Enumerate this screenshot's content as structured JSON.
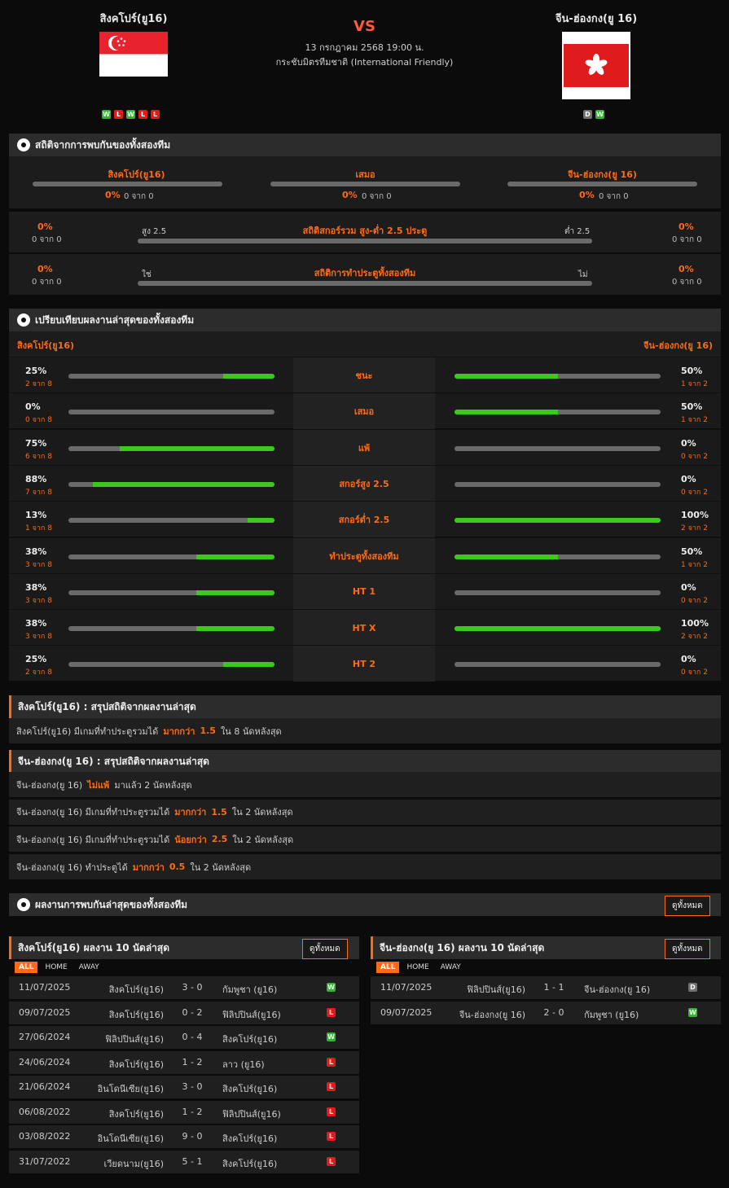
{
  "header": {
    "home_name": "สิงคโปร์(ยู16)",
    "away_name": "จีน-ฮ่องกง(ยู 16)",
    "vs": "VS",
    "date_time": "13 กรกฎาคม 2568 19:00 น.",
    "competition": "กระชับมิตรทีมชาติ (International Friendly)",
    "home_form": [
      "W",
      "L",
      "W",
      "L",
      "L"
    ],
    "away_form": [
      "D",
      "W"
    ]
  },
  "h2h": {
    "title": "สถิติจากการพบกันของทั้งสองทีม",
    "cols": [
      {
        "label": "สิงคโปร์(ยู16)",
        "pct": "0%",
        "count": "0 จาก 0"
      },
      {
        "label": "เสมอ",
        "pct": "0%",
        "count": "0 จาก 0"
      },
      {
        "label": "จีน-ฮ่องกง(ยู 16)",
        "pct": "0%",
        "count": "0 จาก 0"
      }
    ],
    "ou": {
      "title": "สถิติสกอร์รวม สูง-ต่ำ 2.5 ประตู",
      "left_label": "สูง 2.5",
      "right_label": "ต่ำ 2.5",
      "left_pct": "0%",
      "left_count": "0 จาก 0",
      "right_pct": "0%",
      "right_count": "0 จาก 0"
    },
    "btts": {
      "title": "สถิติการทำประตูทั้งสองทีม",
      "left_label": "ใช่",
      "right_label": "ไม่",
      "left_pct": "0%",
      "left_count": "0 จาก 0",
      "right_pct": "0%",
      "right_count": "0 จาก 0"
    }
  },
  "compare": {
    "title": "เปรียบเทียบผลงานล่าสุดของทั้งสองทีม",
    "home_name": "สิงคโปร์(ยู16)",
    "away_name": "จีน-ฮ่องกง(ยู 16)",
    "rows": [
      {
        "label": "ชนะ",
        "home_pct": "25%",
        "home_count": "2 จาก 8",
        "home_val": 0.25,
        "away_pct": "50%",
        "away_count": "1 จาก 2",
        "away_val": 0.5
      },
      {
        "label": "เสมอ",
        "home_pct": "0%",
        "home_count": "0 จาก 8",
        "home_val": 0,
        "away_pct": "50%",
        "away_count": "1 จาก 2",
        "away_val": 0.5
      },
      {
        "label": "แพ้",
        "home_pct": "75%",
        "home_count": "6 จาก 8",
        "home_val": 0.75,
        "away_pct": "0%",
        "away_count": "0 จาก 2",
        "away_val": 0
      },
      {
        "label": "สกอร์สูง 2.5",
        "home_pct": "88%",
        "home_count": "7 จาก 8",
        "home_val": 0.88,
        "away_pct": "0%",
        "away_count": "0 จาก 2",
        "away_val": 0
      },
      {
        "label": "สกอร์ต่ำ 2.5",
        "home_pct": "13%",
        "home_count": "1 จาก 8",
        "home_val": 0.13,
        "away_pct": "100%",
        "away_count": "2 จาก 2",
        "away_val": 1
      },
      {
        "label": "ทำประตูทั้งสองทีม",
        "home_pct": "38%",
        "home_count": "3 จาก 8",
        "home_val": 0.38,
        "away_pct": "50%",
        "away_count": "1 จาก 2",
        "away_val": 0.5
      },
      {
        "label": "HT 1",
        "home_pct": "38%",
        "home_count": "3 จาก 8",
        "home_val": 0.38,
        "away_pct": "0%",
        "away_count": "0 จาก 2",
        "away_val": 0
      },
      {
        "label": "HT X",
        "home_pct": "38%",
        "home_count": "3 จาก 8",
        "home_val": 0.38,
        "away_pct": "100%",
        "away_count": "2 จาก 2",
        "away_val": 1
      },
      {
        "label": "HT 2",
        "home_pct": "25%",
        "home_count": "2 จาก 8",
        "home_val": 0.25,
        "away_pct": "0%",
        "away_count": "0 จาก 2",
        "away_val": 0
      }
    ]
  },
  "home_summary": {
    "title": "สิงคโปร์(ยู16) : สรุปสถิติจากผลงานล่าสุด",
    "rows": [
      {
        "a": "สิงคโปร์(ยู16) มีเกมที่ทำประตูรวมได้",
        "b": "มากกว่า",
        "c": "1.5",
        "d": "ใน 8 นัดหลังสุด"
      }
    ]
  },
  "away_summary": {
    "title": "จีน-ฮ่องกง(ยู 16) : สรุปสถิติจากผลงานล่าสุด",
    "rows": [
      {
        "a": "จีน-ฮ่องกง(ยู 16)",
        "b": "ไม่แพ้",
        "c": "",
        "d": "มาแล้ว 2 นัดหลังสุด"
      },
      {
        "a": "จีน-ฮ่องกง(ยู 16) มีเกมที่ทำประตูรวมได้",
        "b": "มากกว่า",
        "c": "1.5",
        "d": "ใน 2 นัดหลังสุด"
      },
      {
        "a": "จีน-ฮ่องกง(ยู 16) มีเกมที่ทำประตูรวมได้",
        "b": "น้อยกว่า",
        "c": "2.5",
        "d": "ใน 2 นัดหลังสุด"
      },
      {
        "a": "จีน-ฮ่องกง(ยู 16) ทำประตูได้",
        "b": "มากกว่า",
        "c": "0.5",
        "d": "ใน 2 นัดหลังสุด"
      }
    ]
  },
  "recent": {
    "title": "ผลงานการพบกันล่าสุดของทั้งสองทีม",
    "view_all": "ดูทั้งหมด",
    "tabs": [
      "ALL",
      "HOME",
      "AWAY"
    ],
    "home": {
      "title": "สิงคโปร์(ยู16) ผลงาน 10 นัดล่าสุด",
      "matches": [
        {
          "date": "11/07/2025",
          "home": "สิงคโปร์(ยู16)",
          "score": "3 - 0",
          "away": "กัมพูชา (ยู16)",
          "res": "W"
        },
        {
          "date": "09/07/2025",
          "home": "สิงคโปร์(ยู16)",
          "score": "0 - 2",
          "away": "ฟิลิปปินส์(ยู16)",
          "res": "L"
        },
        {
          "date": "27/06/2024",
          "home": "ฟิลิปปินส์(ยู16)",
          "score": "0 - 4",
          "away": "สิงคโปร์(ยู16)",
          "res": "W"
        },
        {
          "date": "24/06/2024",
          "home": "สิงคโปร์(ยู16)",
          "score": "1 - 2",
          "away": "ลาว (ยู16)",
          "res": "L"
        },
        {
          "date": "21/06/2024",
          "home": "อินโดนีเซีย(ยู16)",
          "score": "3 - 0",
          "away": "สิงคโปร์(ยู16)",
          "res": "L"
        },
        {
          "date": "06/08/2022",
          "home": "สิงคโปร์(ยู16)",
          "score": "1 - 2",
          "away": "ฟิลิปปินส์(ยู16)",
          "res": "L"
        },
        {
          "date": "03/08/2022",
          "home": "อินโดนีเซีย(ยู16)",
          "score": "9 - 0",
          "away": "สิงคโปร์(ยู16)",
          "res": "L"
        },
        {
          "date": "31/07/2022",
          "home": "เวียดนาม(ยู16)",
          "score": "5 - 1",
          "away": "สิงคโปร์(ยู16)",
          "res": "L"
        }
      ]
    },
    "away": {
      "title": "จีน-ฮ่องกง(ยู 16) ผลงาน 10 นัดล่าสุด",
      "matches": [
        {
          "date": "11/07/2025",
          "home": "ฟิลิปปินส์(ยู16)",
          "score": "1 - 1",
          "away": "จีน-ฮ่องกง(ยู 16)",
          "res": "D"
        },
        {
          "date": "09/07/2025",
          "home": "จีน-ฮ่องกง(ยู 16)",
          "score": "2 - 0",
          "away": "กัมพูชา (ยู16)",
          "res": "W"
        }
      ]
    }
  },
  "colors": {
    "accent": "#ff6a13",
    "win": "#2fb52f",
    "loss": "#e01b1b",
    "draw": "#707070",
    "bar_fill": "#3cc81d"
  }
}
